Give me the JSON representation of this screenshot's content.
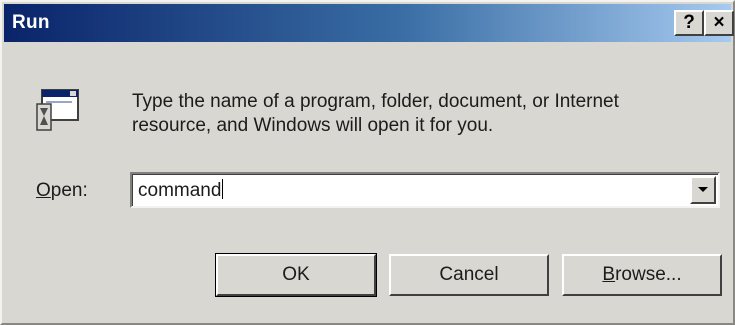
{
  "window": {
    "title": "Run",
    "help_label": "?",
    "close_label": "×"
  },
  "icon": "run-icon",
  "prompt_line1": "Type the name of a program, folder, document, or Internet",
  "prompt_line2": "resource, and Windows will open it for you.",
  "open": {
    "label_mnemonic": "O",
    "label_rest": "pen:",
    "value": "command"
  },
  "buttons": {
    "ok": "OK",
    "cancel": "Cancel",
    "browse_mnemonic": "B",
    "browse_rest": "rowse..."
  },
  "colors": {
    "title_start": "#0a246a",
    "title_end": "#a6caf0",
    "face": "#d9d7d1"
  }
}
